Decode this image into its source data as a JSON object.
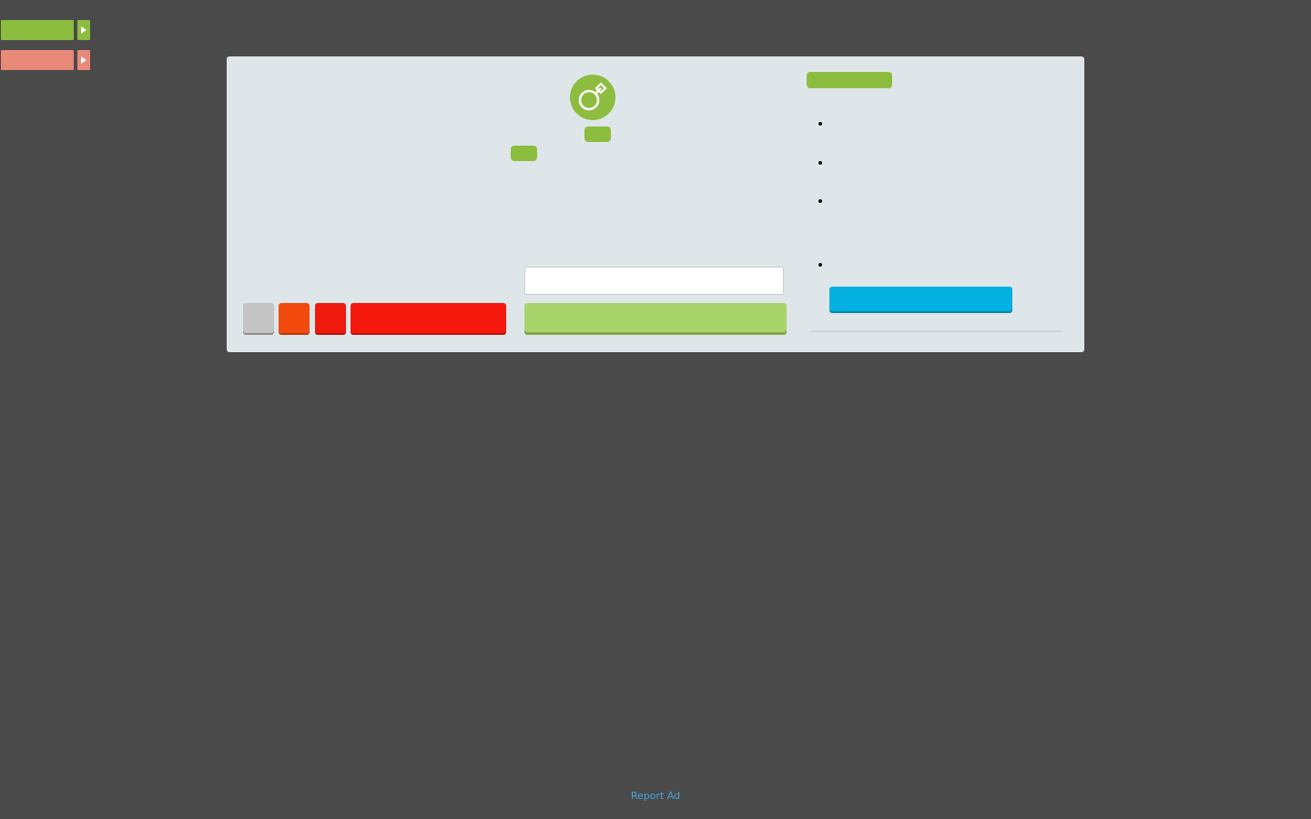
{
  "side_tabs": [
    {
      "label": "",
      "color": "#8cbd3f",
      "arrow_icon": "play-triangle"
    },
    {
      "label": "",
      "color": "#e8897a",
      "arrow_icon": "play-triangle"
    }
  ],
  "panel": {
    "logo_icon": "male-symbol",
    "badges": [
      "",
      ""
    ],
    "header_badge": "",
    "bullet_items": [
      "",
      "",
      "",
      ""
    ],
    "input": {
      "value": "",
      "placeholder": ""
    },
    "buttons": {
      "gray": {
        "label": "",
        "color": "#c4c4c4"
      },
      "orange": {
        "label": "",
        "color": "#f24a0c"
      },
      "red_small": {
        "label": "",
        "color": "#f0190d"
      },
      "red_wide": {
        "label": "",
        "color": "#f5190d"
      },
      "green_wide": {
        "label": "",
        "color": "#a9d46c"
      },
      "blue": {
        "label": "",
        "color": "#03b0e0"
      }
    }
  },
  "footer": {
    "report_ad": "Report Ad"
  }
}
